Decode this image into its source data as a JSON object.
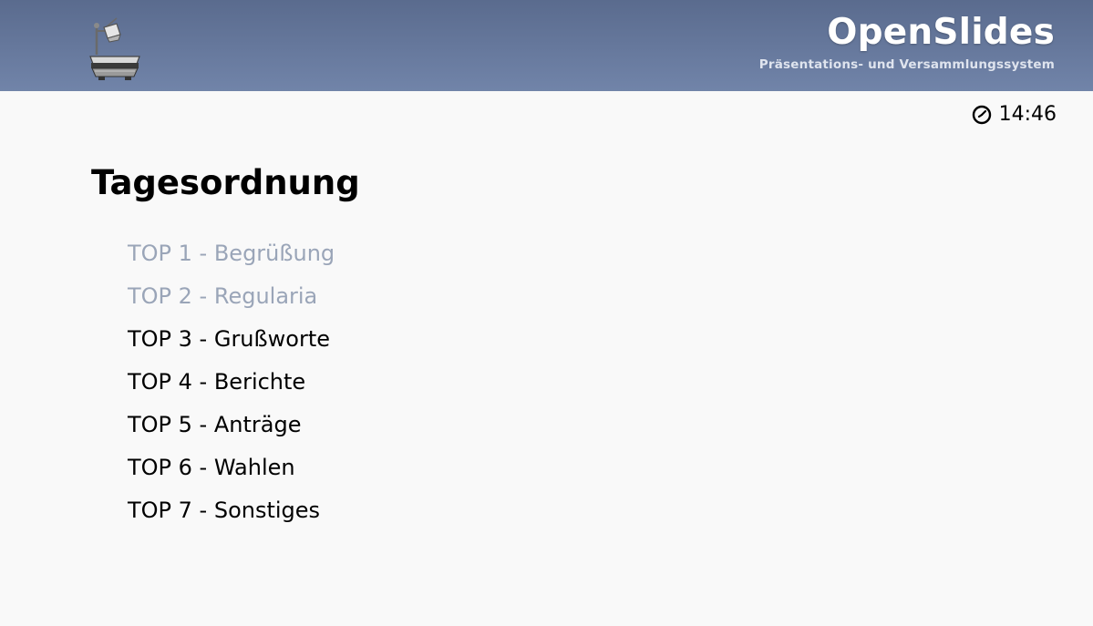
{
  "header": {
    "brand_title": "OpenSlides",
    "brand_subtitle": "Präsentations- und Versammlungssystem",
    "logo_icon": "overhead-projector-icon",
    "gradient_top": "#5a6b8e",
    "gradient_bottom": "#7184a9"
  },
  "clock": {
    "icon": "clock-icon",
    "time": "14:46"
  },
  "slide": {
    "title": "Tagesordnung",
    "items": [
      {
        "label": "TOP 1 - Begrüßung",
        "done": true
      },
      {
        "label": "TOP 2 - Regularia",
        "done": true
      },
      {
        "label": "TOP 3 - Grußworte",
        "done": false
      },
      {
        "label": "TOP 4 - Berichte",
        "done": false
      },
      {
        "label": "TOP 5 - Anträge",
        "done": false
      },
      {
        "label": "TOP 6 - Wahlen",
        "done": false
      },
      {
        "label": "TOP 7 - Sonstiges",
        "done": false
      }
    ]
  },
  "colors": {
    "done_item": "#9aa5b8",
    "active_item": "#000000",
    "background": "#f9f9f9"
  }
}
